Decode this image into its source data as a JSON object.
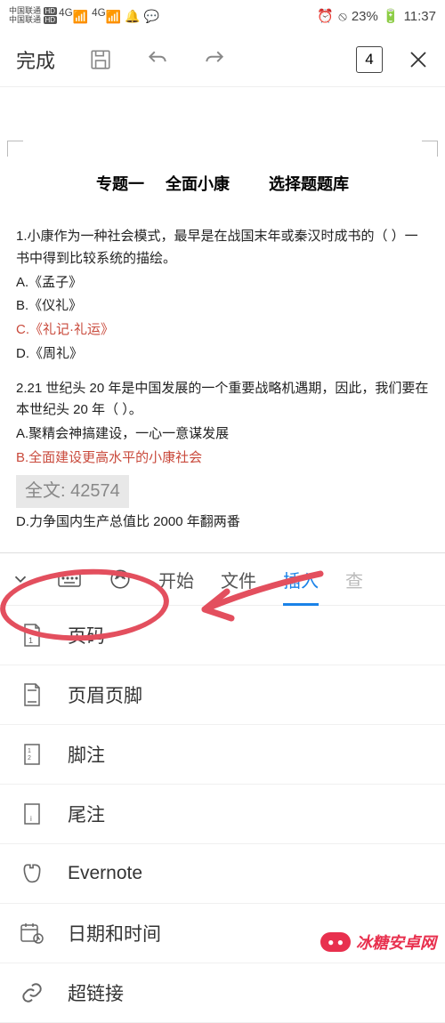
{
  "status": {
    "carrier": "中国联通",
    "network": "4G",
    "battery": "23%",
    "time": "11:37",
    "silent": "⦸"
  },
  "toolbar": {
    "done": "完成",
    "page_count": "4"
  },
  "doc": {
    "title1": "专题一",
    "title2": "全面小康",
    "title3": "选择题题库",
    "q1": "1.小康作为一种社会模式，最早是在战国末年或秦汉时成书的（   ）一书中得到比较系统的描绘。",
    "q1a": "A.《孟子》",
    "q1b": "B.《仪礼》",
    "q1c": "C.《礼记·礼运》",
    "q1d": "D.《周礼》",
    "q2": "2.21 世纪头 20 年是中国发展的一个重要战略机遇期，因此，我们要在本世纪头 20 年（   ）。",
    "q2a": "A.聚精会神搞建设，一心一意谋发展",
    "q2b": "B.全面建设更高水平的小康社会",
    "word_count": "全文: 42574",
    "q2d": "D.力争国内生产总值比 2000 年翻两番"
  },
  "tabs": {
    "start": "开始",
    "file": "文件",
    "insert": "插入",
    "view_cut": "查"
  },
  "insert_menu": {
    "page_number": "页码",
    "header_footer": "页眉页脚",
    "footnote": "脚注",
    "endnote": "尾注",
    "evernote": "Evernote",
    "datetime": "日期和时间",
    "hyperlink": "超链接"
  },
  "watermark": {
    "text": "冰糖安卓网"
  }
}
